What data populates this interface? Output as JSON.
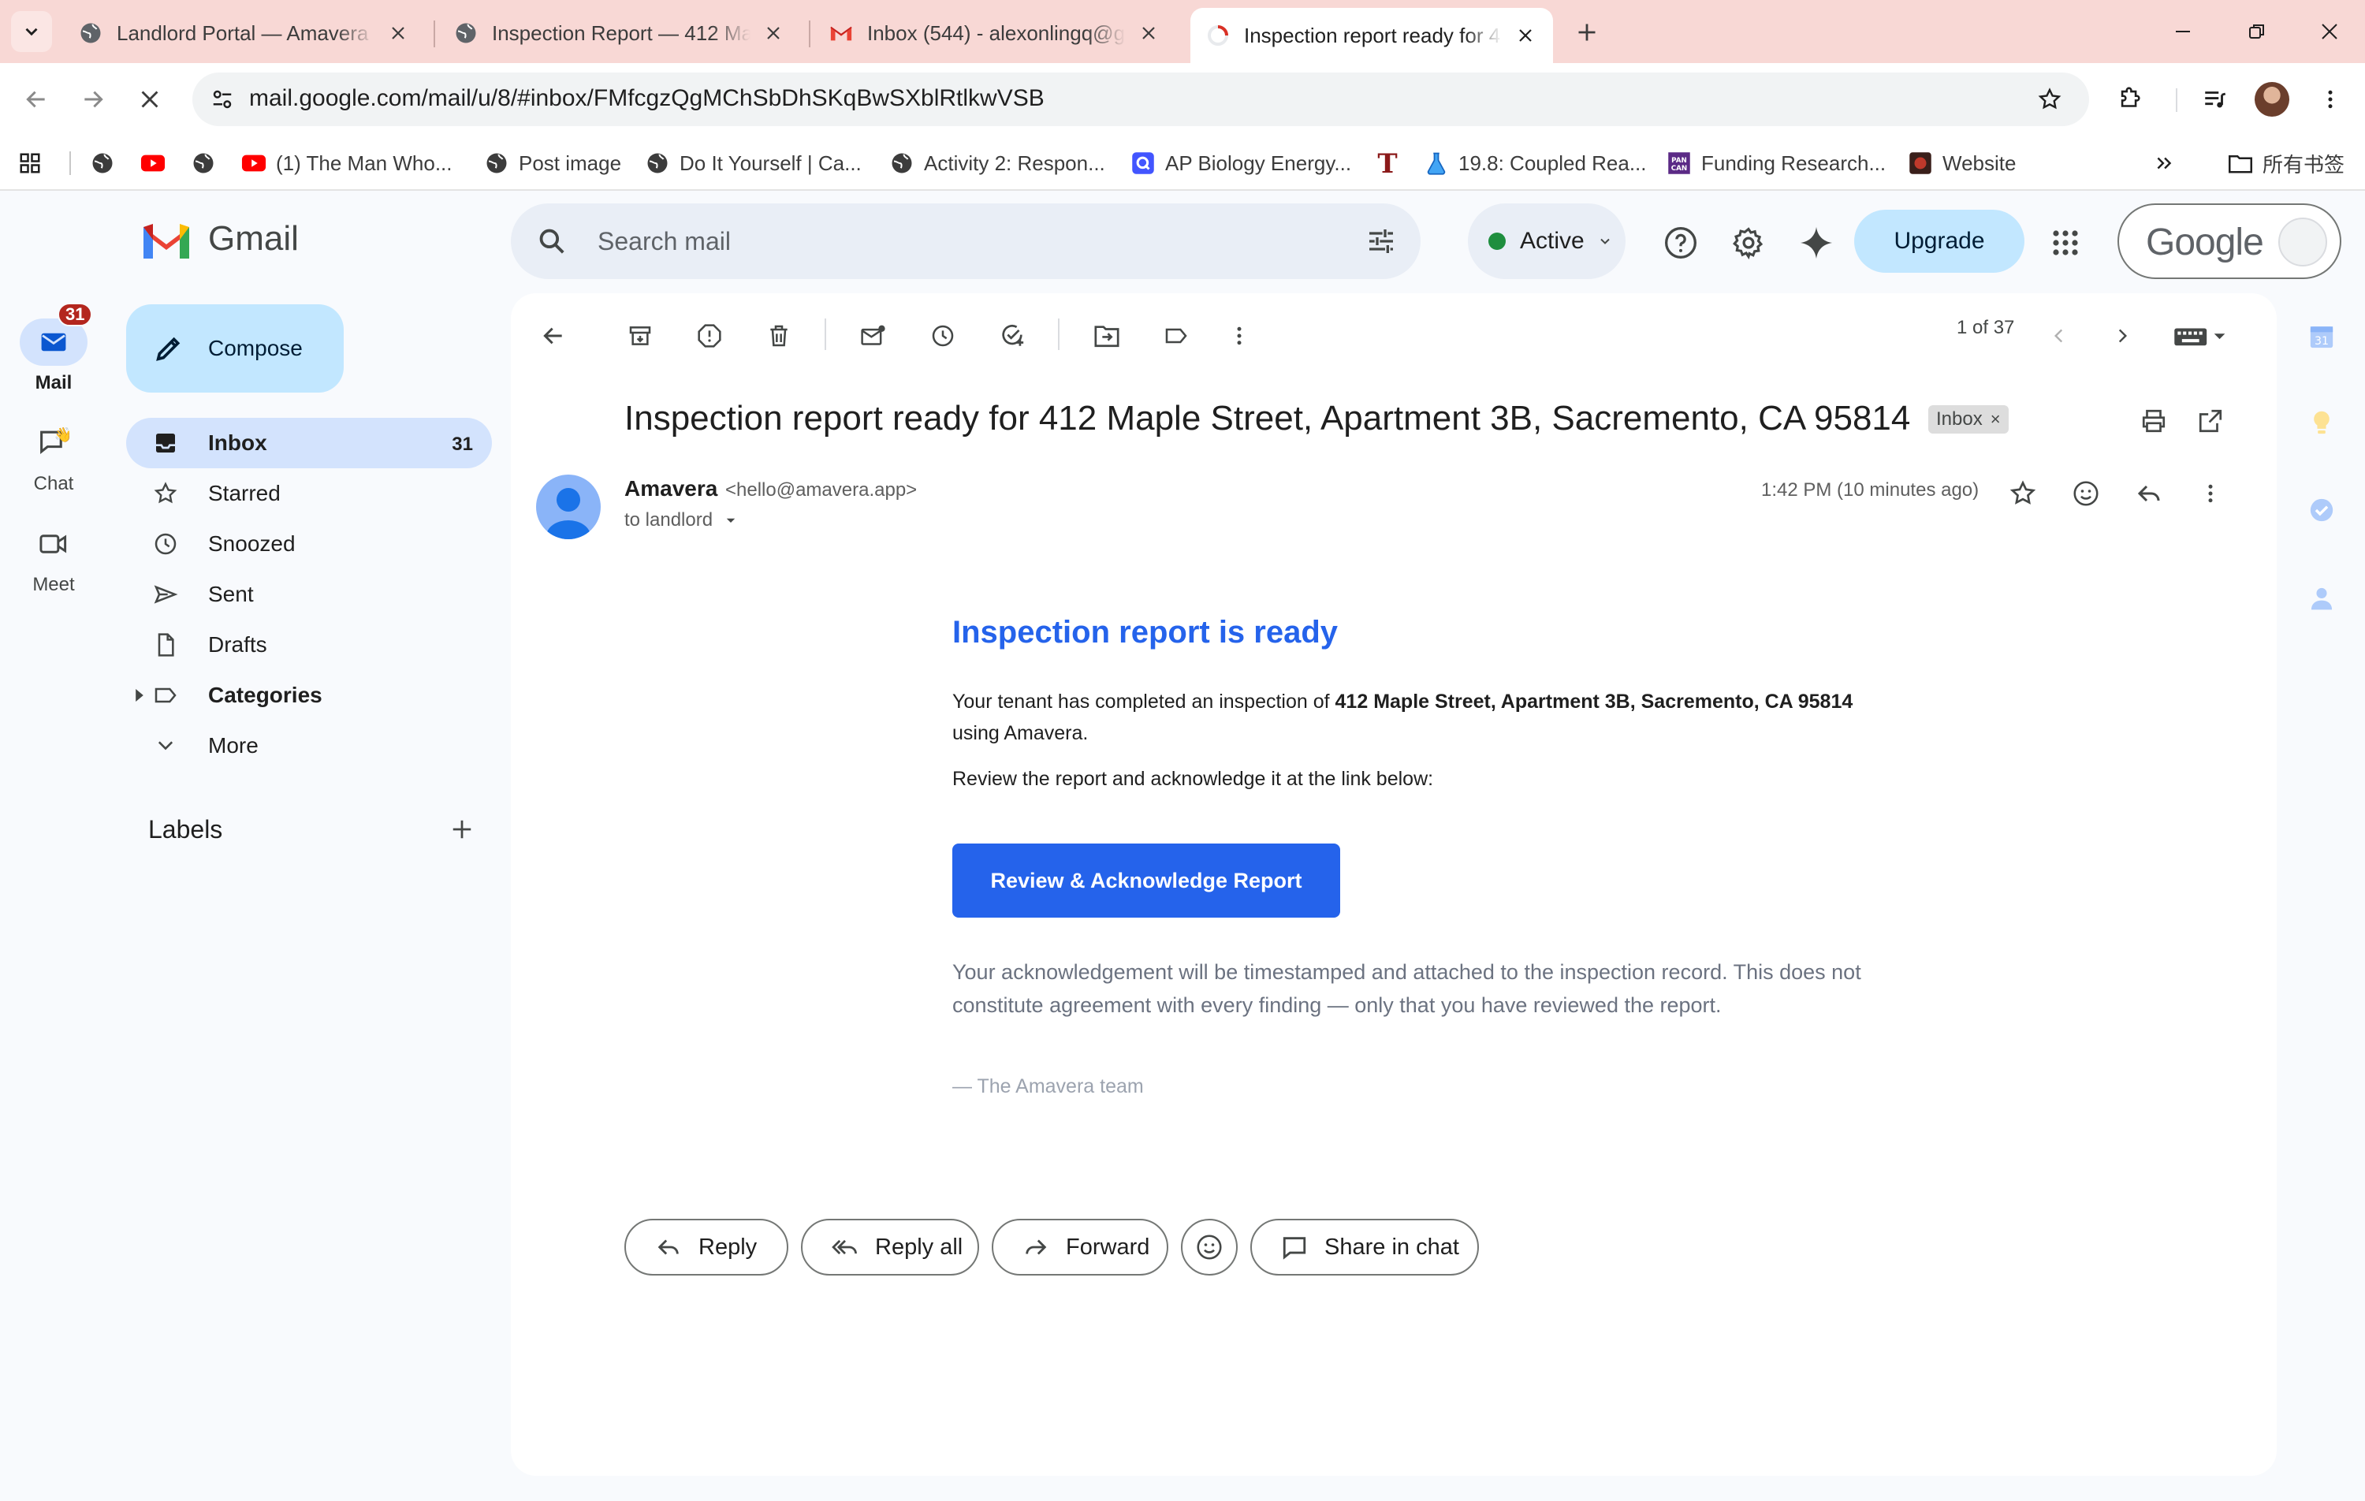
{
  "browser": {
    "tabs": [
      {
        "label": "Landlord Portal — Amavera",
        "favicon": "globe-icon"
      },
      {
        "label": "Inspection Report — 412 Ma",
        "favicon": "globe-icon"
      },
      {
        "label": "Inbox (544) - alexonlingq@g",
        "favicon": "gmail-icon"
      },
      {
        "label": "Inspection report ready for 4",
        "favicon": "gmail-loading-icon",
        "active": true
      }
    ],
    "url": "mail.google.com/mail/u/8/#inbox/FMfcgzQgMChSbDhSKqBwSXblRtlkwVSB",
    "bookmarks": [
      {
        "label": "",
        "icon": "apps-grid-icon"
      },
      {
        "label": "",
        "icon": "globe-icon"
      },
      {
        "label": "",
        "icon": "youtube-icon"
      },
      {
        "label": "",
        "icon": "globe-icon"
      },
      {
        "label": "(1) The Man Who...",
        "icon": "youtube-icon"
      },
      {
        "label": "Post image",
        "icon": "globe-icon"
      },
      {
        "label": "Do It Yourself | Ca...",
        "icon": "globe-icon"
      },
      {
        "label": "Activity 2: Respon...",
        "icon": "globe-icon"
      },
      {
        "label": "AP Biology Energy...",
        "icon": "quizlet-icon"
      },
      {
        "label": "",
        "icon": "times-t-icon"
      },
      {
        "label": "19.8: Coupled Rea...",
        "icon": "flask-icon"
      },
      {
        "label": "Funding Research...",
        "icon": "pancan-icon"
      },
      {
        "label": "Website",
        "icon": "website-icon"
      }
    ],
    "all_bookmarks_label": "所有书签"
  },
  "gmail": {
    "app_name": "Gmail",
    "rail": [
      {
        "label": "Mail",
        "badge": "31"
      },
      {
        "label": "Chat"
      },
      {
        "label": "Meet"
      }
    ],
    "search": {
      "placeholder": "Search mail"
    },
    "status": "Active",
    "upgrade_label": "Upgrade",
    "account_wordmark": "Google",
    "compose_label": "Compose",
    "nav": [
      {
        "label": "Inbox",
        "count": "31",
        "icon": "inbox-icon"
      },
      {
        "label": "Starred",
        "icon": "star-icon"
      },
      {
        "label": "Snoozed",
        "icon": "clock-icon"
      },
      {
        "label": "Sent",
        "icon": "send-icon"
      },
      {
        "label": "Drafts",
        "icon": "draft-icon"
      },
      {
        "label": "Categories",
        "icon": "label-icon"
      },
      {
        "label": "More",
        "icon": "chevron-down-icon"
      }
    ],
    "labels_heading": "Labels",
    "pager": "1 of 37",
    "email": {
      "subject": "Inspection report ready for 412 Maple Street, Apartment 3B, Sacremento, CA 95814",
      "chip": "Inbox",
      "sender_name": "Amavera",
      "sender_email": "<hello@amavera.app>",
      "to": "to landlord",
      "time": "1:42 PM (10 minutes ago)",
      "body": {
        "heading": "Inspection report is ready",
        "p1_prefix": "Your tenant has completed an inspection of ",
        "p1_address": "412 Maple Street, Apartment 3B, Sacremento, CA 95814",
        "p1_suffix": "using Amavera.",
        "p2": "Review the report and acknowledge it at the link below:",
        "cta": "Review & Acknowledge Report",
        "note": "Your acknowledgement will be timestamped and attached to the inspection record. This does not constitute agreement with every finding — only that you have reviewed the report.",
        "signature": "— The Amavera team"
      },
      "actions": {
        "reply": "Reply",
        "reply_all": "Reply all",
        "forward": "Forward",
        "share": "Share in chat"
      }
    }
  },
  "colors": {
    "tabstrip": "#f8d8d5",
    "accent": "#2563eb",
    "compose": "#c2e7ff",
    "selected": "#d3e3fd",
    "badge": "#b3261e"
  }
}
